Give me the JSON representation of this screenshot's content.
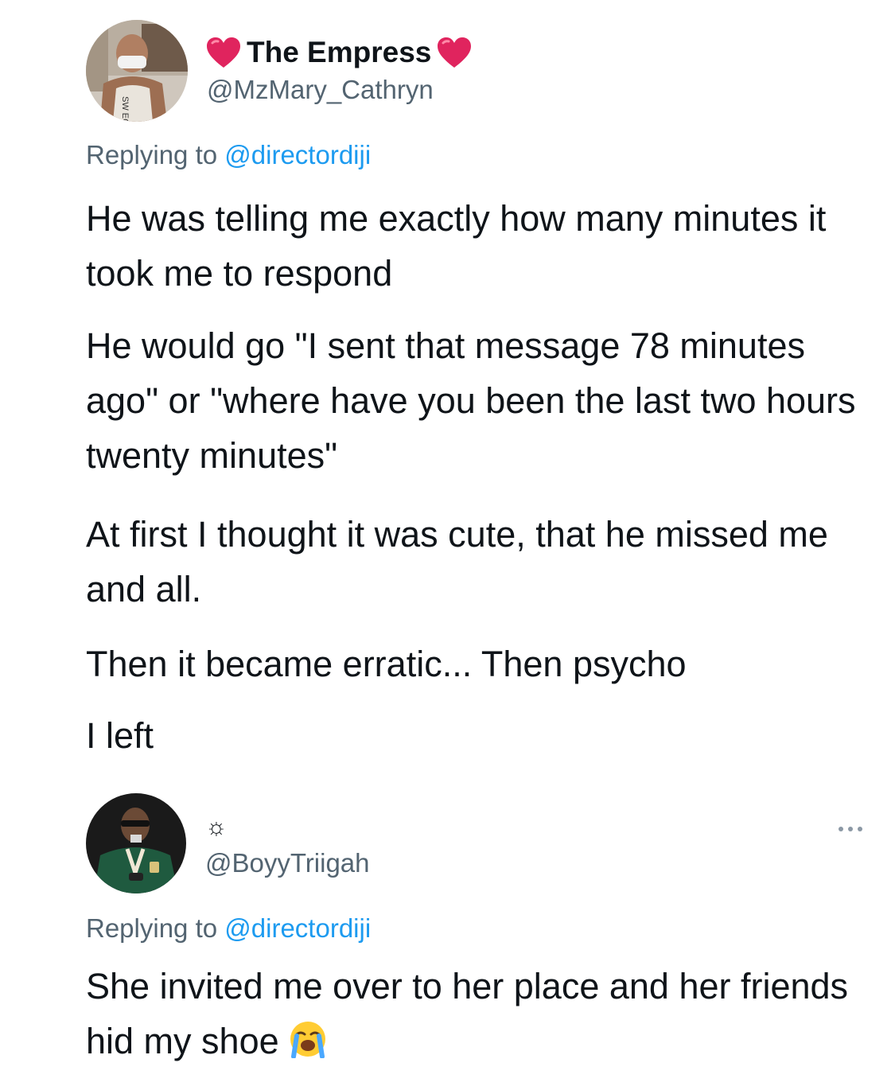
{
  "tweet1": {
    "display_name": "The Empress",
    "handle": "@MzMary_Cathryn",
    "replying_prefix": "Replying to",
    "replying_to": "@directordiji",
    "paragraphs": [
      "He was telling me exactly how many minutes it took me to respond",
      "He would go \"I sent that message 78 minutes ago\" or \"where have you been the last two hours twenty minutes\"",
      "At first I thought it was cute, that he missed me and all.",
      "Then it became erratic... Then psycho",
      "I left"
    ],
    "avatar_shirt_text": "SW EQUI"
  },
  "tweet2": {
    "display_name_symbol": "☼",
    "handle": "@BoyyTriigah",
    "replying_prefix": "Replying to",
    "replying_to": "@directordiji",
    "text": "She invited me over to her place and her friends hid my shoe",
    "emoji_name": "loudly-crying-face-icon"
  },
  "colors": {
    "text": "#0f1419",
    "secondary": "#536471",
    "link": "#1d9bf0",
    "heart": "#e0245e"
  }
}
